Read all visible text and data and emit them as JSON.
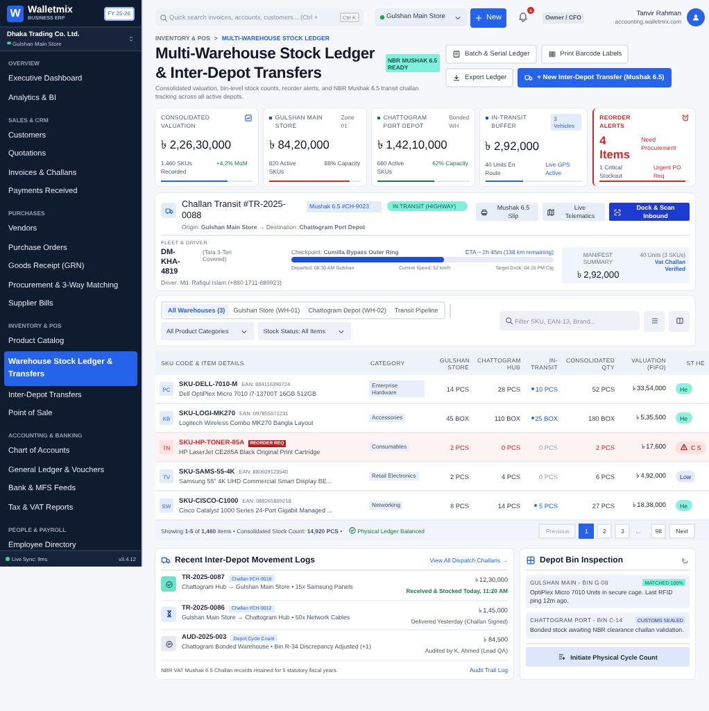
{
  "sidebar": {
    "logo": {
      "mark": "W",
      "name": "Walletmix",
      "subtitle": "BUSINESS ERP"
    },
    "fiscal_year": "FY 25-26",
    "company": "Dhaka Trading Co. Ltd.",
    "branch": "Gulshan Main Store",
    "sections": [
      {
        "title": "OVERVIEW",
        "items": [
          {
            "label": "Executive Dashboard",
            "selected": false
          },
          {
            "label": "Analytics & BI",
            "selected": false
          }
        ]
      },
      {
        "title": "SALES & CRM",
        "items": [
          {
            "label": "Customers",
            "selected": false
          },
          {
            "label": "Quotations",
            "selected": false
          },
          {
            "label": "Invoices & Challans",
            "selected": false
          },
          {
            "label": "Payments Received",
            "selected": false
          }
        ]
      },
      {
        "title": "PURCHASES",
        "items": [
          {
            "label": "Vendors",
            "selected": false
          },
          {
            "label": "Purchase Orders",
            "selected": false
          },
          {
            "label": "Goods Receipt (GRN)",
            "selected": false
          },
          {
            "label": "Procurement & 3-Way Matching",
            "selected": false
          },
          {
            "label": "Supplier Bills",
            "selected": false
          }
        ]
      },
      {
        "title": "INVENTORY & POS",
        "items": [
          {
            "label": "Product Catalog",
            "selected": false
          },
          {
            "label": "Warehouse Stock Ledger & Transfers",
            "selected": true
          },
          {
            "label": "Inter-Depot Transfers",
            "selected": false
          },
          {
            "label": "Point of Sale",
            "selected": false
          }
        ]
      },
      {
        "title": "ACCOUNTING & BANKING",
        "items": [
          {
            "label": "Chart of Accounts",
            "selected": false
          },
          {
            "label": "General Ledger & Vouchers",
            "selected": false
          },
          {
            "label": "Bank & MFS Feeds",
            "selected": false
          },
          {
            "label": "Tax & VAT Reports",
            "selected": false
          }
        ]
      },
      {
        "title": "PEOPLE & PAYROLL",
        "items": [
          {
            "label": "Employee Directory",
            "selected": false
          }
        ]
      }
    ],
    "sync_status": "Live Sync: 9ms",
    "version": "v3.4.12"
  },
  "topbar": {
    "search": {
      "placeholder": "Quick search invoices, accounts, customers... (Ctrl +",
      "shortcut": "Ctrl K"
    },
    "store": "Gulshan Main Store",
    "new_button": "New",
    "notification_count": "4",
    "role": "Owner / CFO",
    "user": {
      "name": "Tanvir Rahman",
      "email": "accounting.walletmix.com"
    }
  },
  "breadcrumb": [
    {
      "label": "INVENTORY & POS",
      "selected": false
    },
    {
      "label": ">",
      "selected": false
    },
    {
      "label": "MULTI-WAREHOUSE STOCK LEDGER",
      "selected": true
    }
  ],
  "page": {
    "title": "Multi-Warehouse Stock Ledger & Inter-Depot Transfers",
    "badge": "NBR MUSHAK 6.5 READY",
    "description": "Consolidated valuation, bin-level stock counts, reorder alerts, and NBR Mushak 6.5 transit challan tracking across all active depots.",
    "actions": [
      {
        "label": "Batch & Serial Ledger",
        "kind": "ledger",
        "primary": false
      },
      {
        "label": "Print Barcode Labels",
        "kind": "barcode",
        "primary": false
      },
      {
        "label": "Export Ledger",
        "kind": "export",
        "primary": false
      },
      {
        "label": "+ New Inter-Depot Transfer (Mushak 6.5)",
        "kind": "transfer",
        "primary": true
      }
    ]
  },
  "kpis": [
    {
      "kind": "valuation",
      "title": "CONSOLIDATED VALUATION",
      "value": "৳ 2,26,30,000",
      "foot_left": "1,460 SKUs Recorded",
      "foot_right": {
        "text": "+4.2% MoM",
        "kind": "positive"
      },
      "level": 0.73,
      "color": "#2563eb"
    },
    {
      "kind": "warehouse",
      "title": "GULSHAN MAIN STORE",
      "tag": "Zone 01",
      "dot": {
        "color": "#1d4ed8"
      },
      "value": "৳ 84,20,000",
      "foot_left": "820 Active SKUs",
      "foot_right": {
        "text": "88% Capacity",
        "kind": "neutral"
      },
      "level": 0.88,
      "color": "#dc2626"
    },
    {
      "kind": "warehouse",
      "title": "CHATTOGRAM PORT DEPOT",
      "tag": "Bonded WH",
      "dot": {
        "color": "#15803d"
      },
      "value": "৳ 1,42,10,000",
      "foot_left": "660 Active SKUs",
      "foot_right": {
        "text": "62% Capacity",
        "kind": "positive"
      },
      "level": 0.62,
      "color": "#15803d"
    },
    {
      "kind": "transit",
      "title": "IN-TRANSIT BUFFER",
      "tag": "3 Vehicles",
      "dot": {
        "color": "#1d4ed8"
      },
      "value": "৳ 2,92,000",
      "foot_left": "40 Units En Route",
      "foot_right": {
        "text": "Live GPS Active",
        "kind": "info"
      },
      "level": 0.4,
      "color": "#2563eb"
    },
    {
      "kind": "alert",
      "title": "REORDER ALERTS",
      "value": "4 Items",
      "note": "Need Procurement",
      "foot_left": "1 Critical Stockout",
      "foot_right": {
        "text": "Urgent PO Req",
        "kind": "danger"
      },
      "level": 0.95,
      "color": "#dc2626"
    }
  ],
  "transit": {
    "title": "Challan Transit #TR-2025-0088",
    "tag": "Mushak 6.5 #CH-9023",
    "status": "IN TRANSIT (HIGHWAY)",
    "route": "Origin: **Gulshan Main Store** → Destination: **Chattogram Port Depot**",
    "buttons": [
      {
        "label": "Mushak 6.5 Slip",
        "kind": "print",
        "primary": false
      },
      {
        "label": "Live Telematics",
        "kind": "map",
        "primary": false
      },
      {
        "label": "Dock & Scan Inbound",
        "kind": "scan",
        "primary": true
      }
    ],
    "fleet_label": "FLEET & DRIVER",
    "vehicle": "DM-KHA-4819",
    "vehicle_type": "(Tata 3-Ton Covered)",
    "driver": "Driver: Md. Rafiqul Islam (+880 1711-889923)",
    "checkpoint": "Checkpoint: **Cumilla Bypass Outer Ring**",
    "eta": "ETA ~ 2h 45m (138 km remaining)",
    "level": 0.58,
    "notes": [
      "Departed: 08:30 AM Gulshan",
      "Current Speed: 52 km/h",
      "Target Dock: 04:15 PM Ctg"
    ],
    "manifest": {
      "label": "MANIFEST SUMMARY",
      "value": "৳ 2,92,000",
      "units": "40 Units (3 SKUs)",
      "status": "Vat Challan Verified"
    }
  },
  "filters": {
    "tabs": [
      {
        "label": "All Warehouses (3)",
        "selected": true
      },
      {
        "label": "Gulshan Store (WH-01)",
        "selected": false
      },
      {
        "label": "Chattogram Depot (WH-02)",
        "selected": false
      },
      {
        "label": "Transit Pipeline",
        "selected": false
      }
    ],
    "dropdowns": [
      "All Product Categories",
      "Stock Status: All Items"
    ],
    "search": {
      "placeholder": "Filter SKU, EAN-13, Brand..."
    }
  },
  "table": {
    "columns": [
      "SKU CODE & ITEM DETAILS",
      "CATEGORY",
      "GULSHAN STORE",
      "CHATTOGRAM HUB",
      "IN-TRANSIT",
      "CONSOLIDATED QTY",
      "VALUATION (FIFO)",
      "ST HE"
    ],
    "rows": [
      {
        "kind": "normal",
        "badge": "PC",
        "sku": "SKU-DELL-7010-M",
        "ean": "EAN: 884116390724",
        "name": "Dell OptiPlex Micro 7010 i7-13700T 16GB 512GB",
        "category": "Enterprise Hardware",
        "gulshan": "14 PCS",
        "chattogram": "28 PCS",
        "in_transit": "10 PCS",
        "moving": true,
        "total": "52 PCS",
        "valuation": "৳ 33,54,000",
        "status": {
          "text": "He",
          "kind": "healthy"
        }
      },
      {
        "kind": "normal",
        "badge": "KB",
        "sku": "SKU-LOGI-MK270",
        "ean": "EAN: 097855071231",
        "name": "Logitech Wireless Combo MK270 Bangla Layout",
        "category": "Accessories",
        "gulshan": "45 BOX",
        "chattogram": "110 BOX",
        "in_transit": "25 BOX",
        "moving": true,
        "total": "180 BOX",
        "valuation": "৳ 5,35,500",
        "status": {
          "text": "He",
          "kind": "healthy"
        }
      },
      {
        "kind": "critical",
        "badge": "TN",
        "sku": "SKU-HP-TONER-85A",
        "flag": "REORDER REQ",
        "name": "HP LaserJet CE285A Black Original Print Cartridge",
        "category": "Consumables",
        "gulshan": "2 PCS",
        "chattogram": "0 PCS",
        "in_transit": "0 PCS",
        "moving": false,
        "total": "2 PCS",
        "valuation": "৳ 17,600",
        "status": {
          "text": "C S",
          "kind": "critical"
        }
      },
      {
        "kind": "normal",
        "badge": "TV",
        "sku": "SKU-SAMS-55-4K",
        "ean": "EAN: 880609123540",
        "name": "Samsung 55\" 4K UHD Commercial Smart Display BE...",
        "category": "Retail Electronics",
        "gulshan": "2 PCS",
        "chattogram": "4 PCS",
        "in_transit": "0 PCS",
        "moving": false,
        "total": "6 PCS",
        "valuation": "৳ 4,92,000",
        "status": {
          "text": "Low",
          "kind": "low"
        }
      },
      {
        "kind": "normal",
        "badge": "SW",
        "sku": "SKU-CISCO-C1000",
        "ean": "EAN: 088265889218",
        "name": "Cisco Catalyst 1000 Series 24-Port Gigabit Managed ...",
        "category": "Networking",
        "gulshan": "8 PCS",
        "chattogram": "14 PCS",
        "in_transit": "5 PCS",
        "moving": true,
        "total": "27 PCS",
        "valuation": "৳ 18,38,000",
        "status": {
          "text": "He",
          "kind": "healthy"
        }
      }
    ],
    "summary": "Showing **1-5** of **1,460** items  •  Consolidated Stock Count: **14,920 PCS**  •",
    "balance": "Physical Ledger Balanced",
    "pagination": [
      {
        "label": "Previous",
        "kind": "nav",
        "disabled": true,
        "selected": false
      },
      {
        "label": "1",
        "kind": "page",
        "disabled": false,
        "selected": true
      },
      {
        "label": "2",
        "kind": "page",
        "disabled": false,
        "selected": false
      },
      {
        "label": "3",
        "kind": "page",
        "disabled": false,
        "selected": false
      },
      {
        "label": "...",
        "kind": "gap"
      },
      {
        "label": "98",
        "kind": "page",
        "disabled": false,
        "selected": false
      },
      {
        "label": "Next",
        "kind": "nav",
        "disabled": false,
        "selected": false
      }
    ]
  },
  "movement_logs": {
    "title": "Recent Inter-Depot Movement Logs",
    "link": "View All Dispatch Challans →",
    "items": [
      {
        "kind": "received",
        "id": "TR-2025-0087",
        "tag": "Challan #CH-9018",
        "description": "Chattogram Hub → Gulshan Main Store • 15x Samsung Panels",
        "amount": "৳ 12,30,000",
        "status": {
          "text": "Received & Stocked Today, 11:20 AM",
          "kind": "success"
        }
      },
      {
        "kind": "pending",
        "id": "TR-2025-0086",
        "tag": "Challan #CH-9012",
        "description": "Gulshan Main Store → Chattogram Hub • 50x Network Cables",
        "amount": "৳ 1,45,000",
        "status": {
          "text": "Delivered Yesterday (Challan Signed)",
          "kind": "neutral"
        }
      },
      {
        "kind": "audit",
        "id": "AUD-2025-003",
        "tag": "Depot Cycle Count",
        "description": "Chattogram Bonded Warehouse • Bin R-34 Discrepancy Adjusted (+1)",
        "amount": "৳ 84,500",
        "status": {
          "text": "Audited by K. Ahmed (Lead QA)",
          "kind": "neutral"
        }
      }
    ],
    "footer": "NBR VAT Mushak 6.5 Challan records retained for 5 statutory fiscal years.",
    "footer_link": "Audit Trail Log"
  },
  "bin_inspection": {
    "title": "Depot Bin Inspection",
    "bins": [
      {
        "location": "GULSHAN MAIN - BIN G-08",
        "tag": {
          "text": "MATCHED 100%",
          "kind": "success"
        },
        "text": "OptiPlex Micro 7010 Units in secure cage. Last RFID ping 12m ago."
      },
      {
        "location": "CHATTOGRAM PORT - BIN C-14",
        "tag": {
          "text": "CUSTOMS SEALED",
          "kind": "info"
        },
        "text": "Bonded stock awaiting NBR clearance challan validation."
      }
    ],
    "button": "Initiate Physical Cycle Count"
  }
}
